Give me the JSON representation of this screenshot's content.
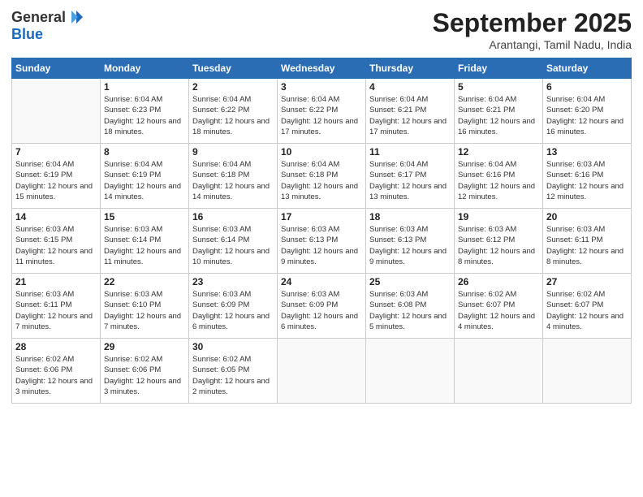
{
  "header": {
    "logo_general": "General",
    "logo_blue": "Blue",
    "title": "September 2025",
    "location": "Arantangi, Tamil Nadu, India"
  },
  "weekdays": [
    "Sunday",
    "Monday",
    "Tuesday",
    "Wednesday",
    "Thursday",
    "Friday",
    "Saturday"
  ],
  "weeks": [
    [
      {
        "day": "",
        "info": ""
      },
      {
        "day": "1",
        "info": "Sunrise: 6:04 AM\nSunset: 6:23 PM\nDaylight: 12 hours\nand 18 minutes."
      },
      {
        "day": "2",
        "info": "Sunrise: 6:04 AM\nSunset: 6:22 PM\nDaylight: 12 hours\nand 18 minutes."
      },
      {
        "day": "3",
        "info": "Sunrise: 6:04 AM\nSunset: 6:22 PM\nDaylight: 12 hours\nand 17 minutes."
      },
      {
        "day": "4",
        "info": "Sunrise: 6:04 AM\nSunset: 6:21 PM\nDaylight: 12 hours\nand 17 minutes."
      },
      {
        "day": "5",
        "info": "Sunrise: 6:04 AM\nSunset: 6:21 PM\nDaylight: 12 hours\nand 16 minutes."
      },
      {
        "day": "6",
        "info": "Sunrise: 6:04 AM\nSunset: 6:20 PM\nDaylight: 12 hours\nand 16 minutes."
      }
    ],
    [
      {
        "day": "7",
        "info": "Sunrise: 6:04 AM\nSunset: 6:19 PM\nDaylight: 12 hours\nand 15 minutes."
      },
      {
        "day": "8",
        "info": "Sunrise: 6:04 AM\nSunset: 6:19 PM\nDaylight: 12 hours\nand 14 minutes."
      },
      {
        "day": "9",
        "info": "Sunrise: 6:04 AM\nSunset: 6:18 PM\nDaylight: 12 hours\nand 14 minutes."
      },
      {
        "day": "10",
        "info": "Sunrise: 6:04 AM\nSunset: 6:18 PM\nDaylight: 12 hours\nand 13 minutes."
      },
      {
        "day": "11",
        "info": "Sunrise: 6:04 AM\nSunset: 6:17 PM\nDaylight: 12 hours\nand 13 minutes."
      },
      {
        "day": "12",
        "info": "Sunrise: 6:04 AM\nSunset: 6:16 PM\nDaylight: 12 hours\nand 12 minutes."
      },
      {
        "day": "13",
        "info": "Sunrise: 6:03 AM\nSunset: 6:16 PM\nDaylight: 12 hours\nand 12 minutes."
      }
    ],
    [
      {
        "day": "14",
        "info": "Sunrise: 6:03 AM\nSunset: 6:15 PM\nDaylight: 12 hours\nand 11 minutes."
      },
      {
        "day": "15",
        "info": "Sunrise: 6:03 AM\nSunset: 6:14 PM\nDaylight: 12 hours\nand 11 minutes."
      },
      {
        "day": "16",
        "info": "Sunrise: 6:03 AM\nSunset: 6:14 PM\nDaylight: 12 hours\nand 10 minutes."
      },
      {
        "day": "17",
        "info": "Sunrise: 6:03 AM\nSunset: 6:13 PM\nDaylight: 12 hours\nand 9 minutes."
      },
      {
        "day": "18",
        "info": "Sunrise: 6:03 AM\nSunset: 6:13 PM\nDaylight: 12 hours\nand 9 minutes."
      },
      {
        "day": "19",
        "info": "Sunrise: 6:03 AM\nSunset: 6:12 PM\nDaylight: 12 hours\nand 8 minutes."
      },
      {
        "day": "20",
        "info": "Sunrise: 6:03 AM\nSunset: 6:11 PM\nDaylight: 12 hours\nand 8 minutes."
      }
    ],
    [
      {
        "day": "21",
        "info": "Sunrise: 6:03 AM\nSunset: 6:11 PM\nDaylight: 12 hours\nand 7 minutes."
      },
      {
        "day": "22",
        "info": "Sunrise: 6:03 AM\nSunset: 6:10 PM\nDaylight: 12 hours\nand 7 minutes."
      },
      {
        "day": "23",
        "info": "Sunrise: 6:03 AM\nSunset: 6:09 PM\nDaylight: 12 hours\nand 6 minutes."
      },
      {
        "day": "24",
        "info": "Sunrise: 6:03 AM\nSunset: 6:09 PM\nDaylight: 12 hours\nand 6 minutes."
      },
      {
        "day": "25",
        "info": "Sunrise: 6:03 AM\nSunset: 6:08 PM\nDaylight: 12 hours\nand 5 minutes."
      },
      {
        "day": "26",
        "info": "Sunrise: 6:02 AM\nSunset: 6:07 PM\nDaylight: 12 hours\nand 4 minutes."
      },
      {
        "day": "27",
        "info": "Sunrise: 6:02 AM\nSunset: 6:07 PM\nDaylight: 12 hours\nand 4 minutes."
      }
    ],
    [
      {
        "day": "28",
        "info": "Sunrise: 6:02 AM\nSunset: 6:06 PM\nDaylight: 12 hours\nand 3 minutes."
      },
      {
        "day": "29",
        "info": "Sunrise: 6:02 AM\nSunset: 6:06 PM\nDaylight: 12 hours\nand 3 minutes."
      },
      {
        "day": "30",
        "info": "Sunrise: 6:02 AM\nSunset: 6:05 PM\nDaylight: 12 hours\nand 2 minutes."
      },
      {
        "day": "",
        "info": ""
      },
      {
        "day": "",
        "info": ""
      },
      {
        "day": "",
        "info": ""
      },
      {
        "day": "",
        "info": ""
      }
    ]
  ]
}
